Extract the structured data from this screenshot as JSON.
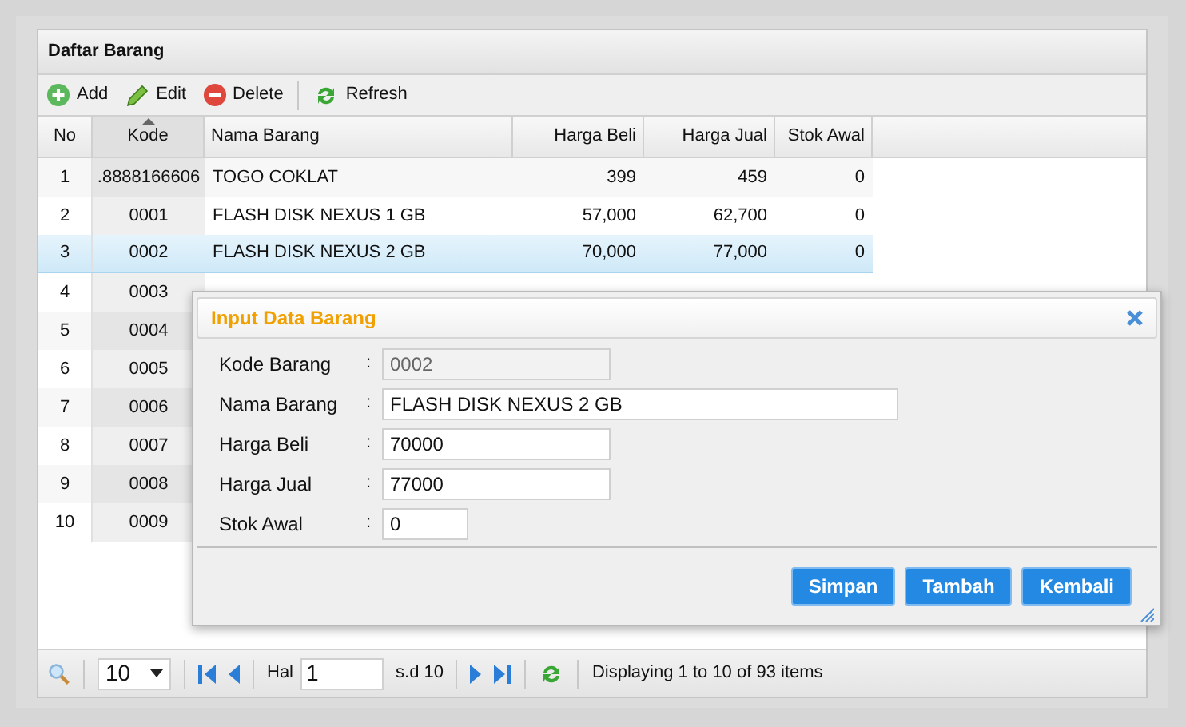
{
  "panel": {
    "title": "Daftar Barang"
  },
  "toolbar": [
    {
      "label": "Add",
      "kind": "add"
    },
    {
      "label": "Edit",
      "kind": "edit"
    },
    {
      "label": "Delete",
      "kind": "delete"
    },
    {
      "label": "Refresh",
      "kind": "refresh"
    }
  ],
  "table": {
    "columns": [
      "No",
      "Kode",
      "Nama Barang",
      "Harga Beli",
      "Harga Jual",
      "Stok Awal"
    ],
    "rows": [
      {
        "no": "1",
        "kode": ".8888166606",
        "nama": "TOGO COKLAT",
        "beli": "399",
        "jual": "459",
        "stok": "0",
        "selected": false
      },
      {
        "no": "2",
        "kode": "0001",
        "nama": "FLASH DISK NEXUS 1 GB",
        "beli": "57,000",
        "jual": "62,700",
        "stok": "0",
        "selected": false
      },
      {
        "no": "3",
        "kode": "0002",
        "nama": "FLASH DISK NEXUS 2 GB",
        "beli": "70,000",
        "jual": "77,000",
        "stok": "0",
        "selected": true
      },
      {
        "no": "4",
        "kode": "0003",
        "selected": false
      },
      {
        "no": "5",
        "kode": "0004",
        "selected": false
      },
      {
        "no": "6",
        "kode": "0005",
        "selected": false
      },
      {
        "no": "7",
        "kode": "0006",
        "selected": false
      },
      {
        "no": "8",
        "kode": "0007",
        "selected": false
      },
      {
        "no": "9",
        "kode": "0008",
        "selected": false
      },
      {
        "no": "10",
        "kode": "0009",
        "selected": false
      }
    ]
  },
  "pager": {
    "page_size": "10",
    "page_label": "Hal",
    "page": "1",
    "of": "s.d 10",
    "status": "Displaying 1 to 10 of 93 items"
  },
  "dialog": {
    "title": "Input Data Barang",
    "fields": [
      {
        "label": "Kode Barang",
        "colon": ":",
        "value": "0002",
        "disabled": true,
        "kind": "code"
      },
      {
        "label": "Nama Barang",
        "colon": ":",
        "value": "FLASH DISK NEXUS 2 GB",
        "disabled": false,
        "kind": "name"
      },
      {
        "label": "Harga Beli",
        "colon": ":",
        "value": "70000",
        "disabled": false,
        "kind": "price"
      },
      {
        "label": "Harga Jual",
        "colon": ":",
        "value": "77000",
        "disabled": false,
        "kind": "price"
      },
      {
        "label": "Stok Awal",
        "colon": ":",
        "value": "0",
        "disabled": false,
        "kind": "count"
      }
    ],
    "buttons": [
      "Simpan",
      "Tambah",
      "Kembali"
    ]
  }
}
